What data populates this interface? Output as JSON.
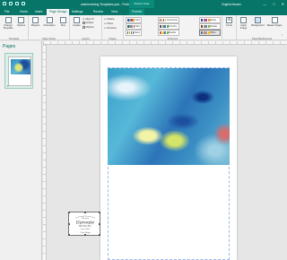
{
  "titlebar": {
    "doc_title": "watermarking Templates.pub - Publisher",
    "context_header": "Picture Tools",
    "user": "Virginia Mauern",
    "win_min": "—",
    "win_max": "□",
    "win_close": "✕"
  },
  "tabs": [
    {
      "label": "File"
    },
    {
      "label": "Home"
    },
    {
      "label": "Insert"
    },
    {
      "label": "Page Design"
    },
    {
      "label": "Mailings"
    },
    {
      "label": "Review"
    },
    {
      "label": "View"
    },
    {
      "label": "Format"
    }
  ],
  "ribbon": {
    "template": {
      "change": "Change Template",
      "options": "Options",
      "group": "Template"
    },
    "page_setup": {
      "margins": "Margins",
      "orientation": "Orientation",
      "size": "Size",
      "group": "Page Setup"
    },
    "layout": {
      "align_to": "Align To",
      "guides": "Guides",
      "objects": "Objects",
      "group": "Layout"
    },
    "pages": {
      "delete": "Delete",
      "move": "Move",
      "rename": "Rename",
      "group": "Pages"
    },
    "schemes": {
      "group": "Schemes",
      "list": [
        {
          "name": "Civic",
          "colors": [
            "#3c5a99",
            "#7aa7d6",
            "#c5533a",
            "#e3a847"
          ]
        },
        {
          "name": "Flow",
          "colors": [
            "#2e6b8c",
            "#58a4b0",
            "#c97f3c",
            "#7d5aa6"
          ]
        },
        {
          "name": "Metro",
          "colors": [
            "#2b7a3d",
            "#9cc34a",
            "#d94a3a",
            "#3b6db3"
          ]
        },
        {
          "name": "Concourse",
          "colors": [
            "#9b2f2f",
            "#d8873a",
            "#4a76b3",
            "#e0c03c"
          ]
        },
        {
          "name": "Foundry",
          "colors": [
            "#4b4b4b",
            "#8f8f8f",
            "#3a78b5",
            "#6aa34a"
          ]
        },
        {
          "name": "Module",
          "colors": [
            "#c95e2a",
            "#edb03a",
            "#3b8fbf",
            "#7bb04a"
          ]
        },
        {
          "name": "Equity",
          "colors": [
            "#4b3f8a",
            "#8a70c2",
            "#d14a5a",
            "#e89a3a"
          ]
        },
        {
          "name": "Median",
          "colors": [
            "#6b4a2a",
            "#b58a55",
            "#4a86b8",
            "#8cb04a"
          ]
        },
        {
          "name": "Office",
          "colors": [
            "#4472c4",
            "#ed7d31",
            "#a5a5a5",
            "#ffc000"
          ]
        }
      ]
    },
    "fonts": "Fonts",
    "page_background": {
      "apply_image": "Apply Image",
      "background": "Background",
      "master_pages": "Master Pages",
      "group": "Page Background"
    },
    "collapse": "⌃"
  },
  "pages_pane": {
    "title": "Pages",
    "thumbnails": [
      {
        "number": "1"
      }
    ]
  },
  "logo": {
    "line1": "Theresa",
    "line2": "Garoute",
    "line3": "DESIGNS",
    "line4": "Cancer Bank",
    "line5": "· Clove Bingo ·"
  },
  "colors": {
    "accent": "#077568",
    "ribbon_bg": "#f3f3f3",
    "workspace_bg": "#e6e6e6"
  }
}
